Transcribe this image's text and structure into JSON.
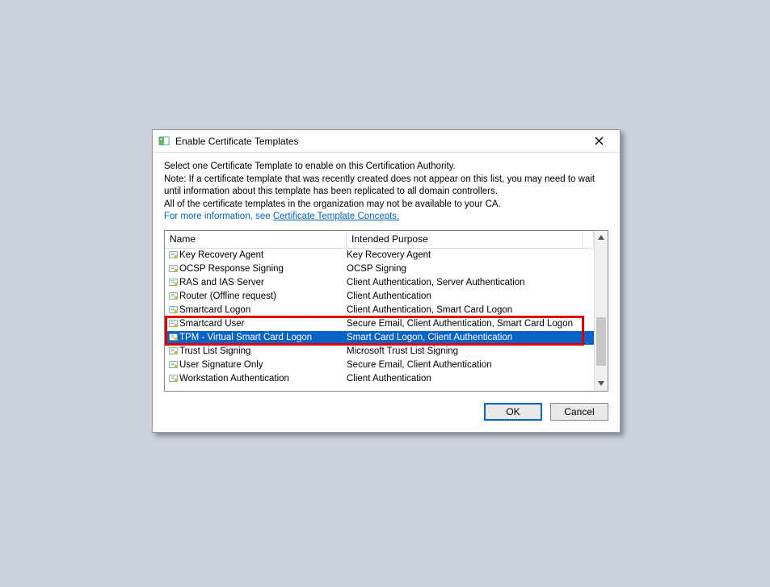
{
  "dialog": {
    "title": "Enable Certificate Templates",
    "intro_line1": "Select one Certificate Template to enable on this Certification Authority.",
    "intro_line2": "Note: If a certificate template that was recently created does not appear on this list, you may need to wait until information about this template has been replicated to all domain controllers.",
    "intro_line3": "All of the certificate templates in the organization may not be available to your CA.",
    "link_prefix": "For more information, see ",
    "link_text": "Certificate Template Concepts.",
    "columns": {
      "name": "Name",
      "purpose": "Intended Purpose"
    },
    "rows": [
      {
        "name": "Key Recovery Agent",
        "purpose": "Key Recovery Agent"
      },
      {
        "name": "OCSP Response Signing",
        "purpose": "OCSP Signing"
      },
      {
        "name": "RAS and IAS Server",
        "purpose": "Client Authentication, Server Authentication"
      },
      {
        "name": "Router (Offline request)",
        "purpose": "Client Authentication"
      },
      {
        "name": "Smartcard Logon",
        "purpose": "Client Authentication, Smart Card Logon"
      },
      {
        "name": "Smartcard User",
        "purpose": "Secure Email, Client Authentication, Smart Card Logon"
      },
      {
        "name": "TPM - Virtual Smart Card Logon",
        "purpose": "Smart Card Logon, Client Authentication"
      },
      {
        "name": "Trust List Signing",
        "purpose": "Microsoft Trust List Signing"
      },
      {
        "name": "User Signature Only",
        "purpose": "Secure Email, Client Authentication"
      },
      {
        "name": "Workstation Authentication",
        "purpose": "Client Authentication"
      }
    ],
    "selected_index": 6,
    "annotation_start_index": 5,
    "annotation_end_index": 6,
    "buttons": {
      "ok": "OK",
      "cancel": "Cancel"
    }
  }
}
